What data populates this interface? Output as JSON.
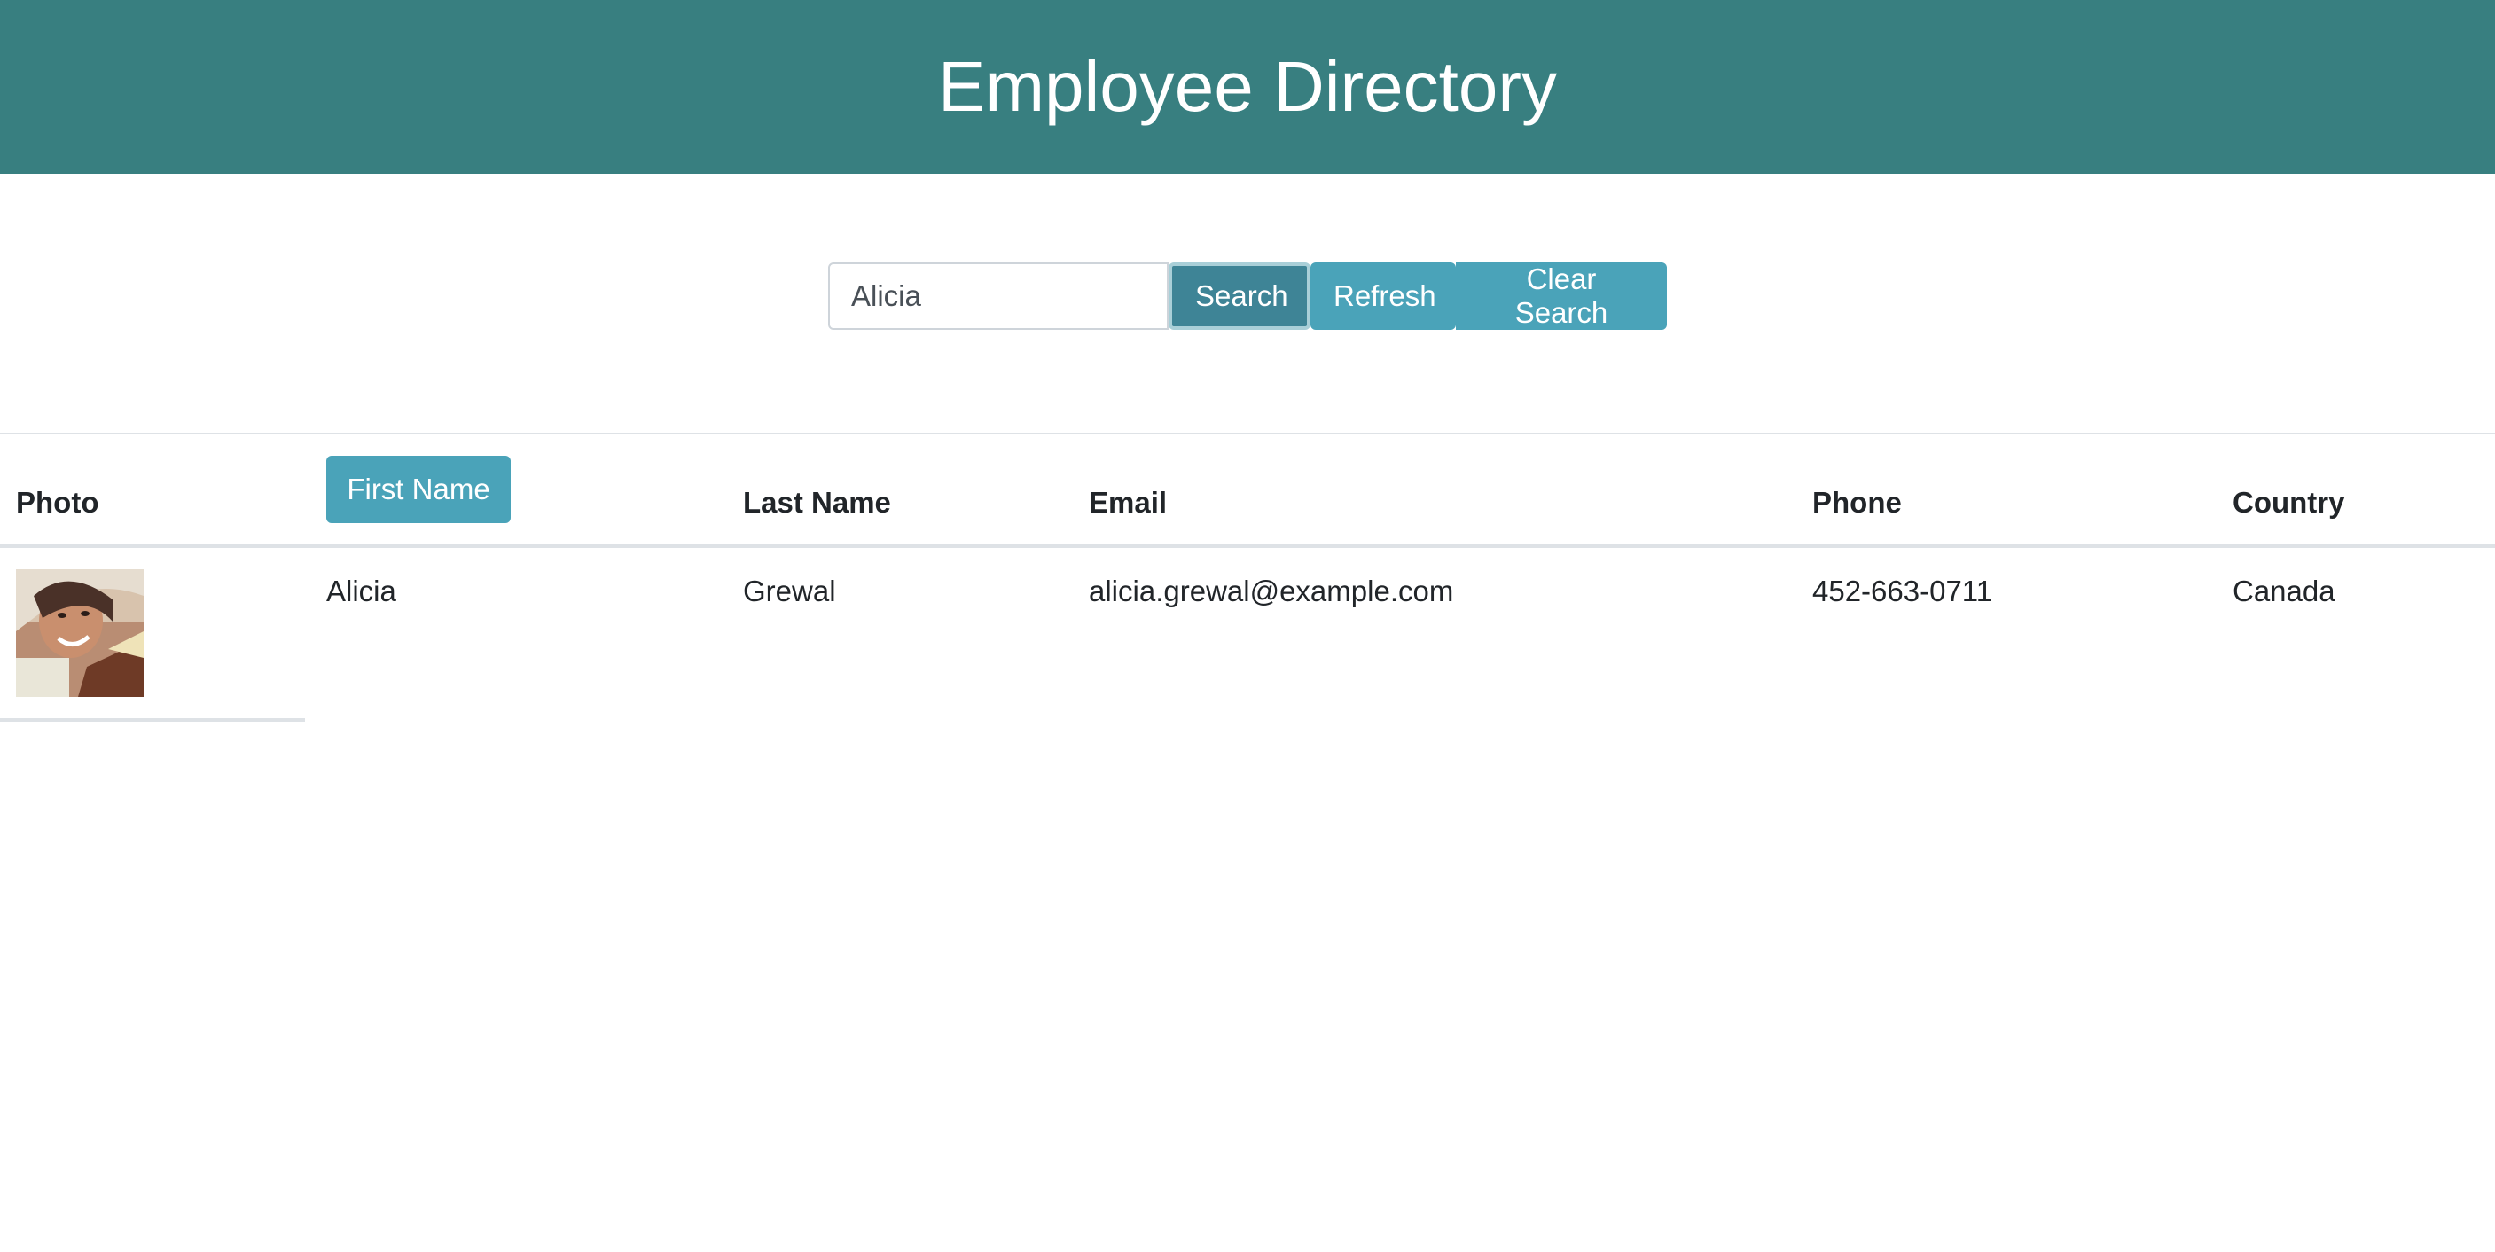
{
  "header": {
    "title": "Employee Directory",
    "background": "#387f80"
  },
  "search": {
    "value": "Alicia",
    "placeholder": "",
    "search_label": "Search",
    "refresh_label": "Refresh",
    "clear_label": "Clear Search"
  },
  "table": {
    "columns": [
      "Photo",
      "First Name",
      "Last Name",
      "Email",
      "Phone",
      "Country"
    ],
    "rows": [
      {
        "first_name": "Alicia",
        "last_name": "Grewal",
        "email": "alicia.grewal@example.com",
        "phone": "452-663-0711",
        "country": "Canada"
      }
    ]
  },
  "colors": {
    "accent": "#4aa3b9",
    "accent_active": "#3e8496"
  }
}
